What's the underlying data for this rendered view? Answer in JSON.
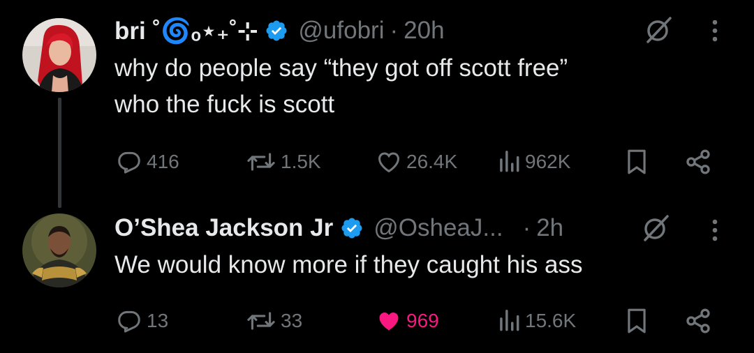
{
  "colors": {
    "background": "#000000",
    "text": "#e7e9ea",
    "muted": "#71767b",
    "verified": "#1d9bf0",
    "like_active": "#f91880"
  },
  "tweets": [
    {
      "display_name": "bri ˚🌀ₒ⋆₊˚⊹",
      "verified": true,
      "handle": "@ufobri",
      "separator": "·",
      "time": "20h",
      "text_lines": [
        "why do people say “they got off scott free”",
        "who the fuck is scott"
      ],
      "stats": {
        "replies": "416",
        "retweets": "1.5K",
        "likes": "26.4K",
        "views": "962K"
      },
      "liked": false,
      "avatar": "avatar-red-hair"
    },
    {
      "display_name": "O’Shea Jackson Jr",
      "verified": true,
      "handle": "@OsheaJ...",
      "separator": "·",
      "time": "2h",
      "text_lines": [
        "We would know more if they caught his ass"
      ],
      "stats": {
        "replies": "13",
        "retweets": "33",
        "likes": "969",
        "views": "15.6K"
      },
      "liked": true,
      "avatar": "avatar-painted-portrait"
    }
  ],
  "icons": [
    "grok-icon",
    "more-icon",
    "reply-icon",
    "retweet-icon",
    "like-icon",
    "views-icon",
    "bookmark-icon",
    "share-icon",
    "verified-badge-icon"
  ]
}
